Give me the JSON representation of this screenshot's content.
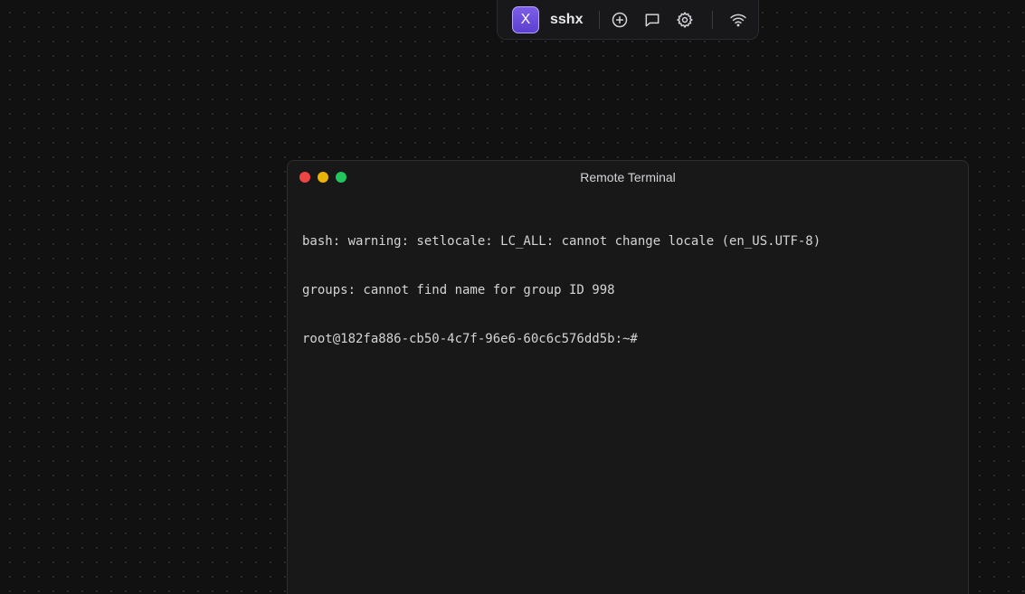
{
  "toolbar": {
    "logo_letter": "X",
    "app_name": "sshx",
    "buttons": [
      {
        "name": "new-terminal",
        "icon": "plus-circle-icon"
      },
      {
        "name": "chat",
        "icon": "chat-bubble-icon"
      },
      {
        "name": "settings",
        "icon": "gear-icon"
      },
      {
        "name": "network",
        "icon": "wifi-icon"
      }
    ]
  },
  "terminal": {
    "title": "Remote Terminal",
    "lines": [
      "bash: warning: setlocale: LC_ALL: cannot change locale (en_US.UTF-8)",
      "groups: cannot find name for group ID 998",
      "root@182fa886-cb50-4c7f-96e6-60c6c576dd5b:~#"
    ]
  },
  "colors": {
    "background": "#111111",
    "accent": "#6d4fe0",
    "close": "#ef4444",
    "minimize": "#eab308",
    "maximize": "#22c55e"
  }
}
